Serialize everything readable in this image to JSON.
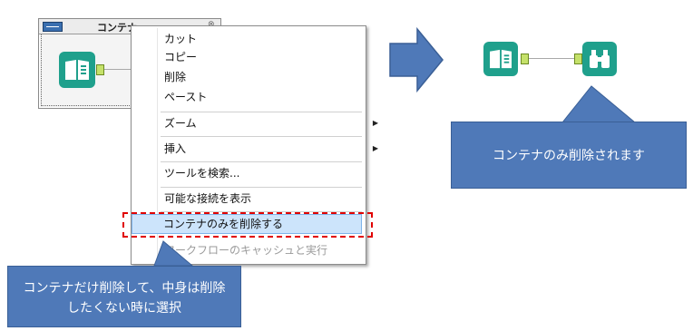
{
  "container": {
    "title": "コンテナ"
  },
  "context_menu": {
    "items": [
      {
        "label": "カット"
      },
      {
        "label": "コピー"
      },
      {
        "label": "削除"
      },
      {
        "label": "ペースト"
      },
      {
        "label": "ズーム"
      },
      {
        "label": "挿入"
      },
      {
        "label": "ツールを検索..."
      },
      {
        "label": "可能な接続を表示"
      },
      {
        "label": "コンテナのみを削除する"
      },
      {
        "label": "ワークフローのキャッシュと実行"
      }
    ]
  },
  "callouts": {
    "left_text": "コンテナだけ削除して、中身は削除したくない時に選択",
    "right_text": "コンテナのみ削除されます"
  },
  "icons": {
    "input_tool": "book-icon",
    "browse_tool": "binoculars-icon",
    "arrow": "right-arrow-icon",
    "submenu": "submenu-arrow-icon"
  },
  "colors": {
    "tool_teal": "#1fa08c",
    "callout_blue": "#4f79b8",
    "highlight_red": "#e00000",
    "selection_blue": "#cce4fb"
  }
}
